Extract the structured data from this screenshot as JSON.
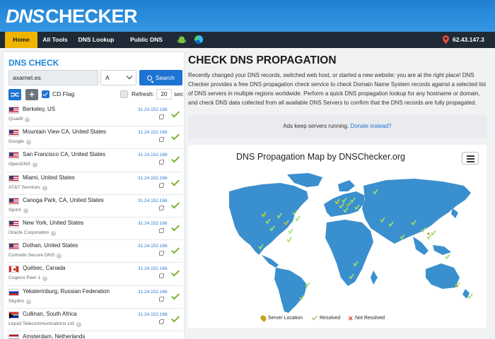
{
  "header": {
    "logo_dns": "DNS",
    "logo_checker": "CHECKER"
  },
  "nav": {
    "home": "Home",
    "all_tools": "All Tools",
    "dns_lookup": "DNS Lookup",
    "public_dns_list": "Public DNS List",
    "ip": "62.43.147.3"
  },
  "left": {
    "title": "DNS CHECK",
    "domain_value": "axarnet.es",
    "record_type": "A",
    "search_label": "Search",
    "cd_flag_label": "CD Flag",
    "refresh_label": "Refresh:",
    "refresh_value": "20",
    "refresh_unit": "sec."
  },
  "servers": [
    {
      "city": "Berkeley, US",
      "provider": "Quad9",
      "ip": "31.24.152.166",
      "flag": "us"
    },
    {
      "city": "Mountain View CA, United States",
      "provider": "Google",
      "ip": "31.24.152.166",
      "flag": "us"
    },
    {
      "city": "San Francisco CA, United States",
      "provider": "OpenDNS",
      "ip": "31.24.152.166",
      "flag": "us"
    },
    {
      "city": "Miami, United States",
      "provider": "AT&T Services",
      "ip": "31.24.152.166",
      "flag": "us"
    },
    {
      "city": "Canoga Park, CA, United States",
      "provider": "Sprint",
      "ip": "31.24.152.166",
      "flag": "us"
    },
    {
      "city": "New York, United States",
      "provider": "Oracle Corporation",
      "ip": "31.24.152.166",
      "flag": "us"
    },
    {
      "city": "Dothan, United States",
      "provider": "Comodo Secure DNS",
      "ip": "31.24.152.166",
      "flag": "us"
    },
    {
      "city": "Québec, Canada",
      "provider": "Cogeco Peer 1",
      "ip": "31.24.152.166",
      "flag": "ca"
    },
    {
      "city": "Yekaterinburg, Russian Federation",
      "provider": "Skydns",
      "ip": "31.24.152.166",
      "flag": "ru"
    },
    {
      "city": "Cullinan, South Africa",
      "provider": "Liquid Telecommunications Ltd",
      "ip": "31.24.152.166",
      "flag": "za"
    },
    {
      "city": "Amsterdam, Netherlands",
      "provider": "",
      "ip": "",
      "flag": "nl"
    }
  ],
  "main": {
    "title": "CHECK DNS PROPAGATION",
    "description": "Recently changed your DNS records, switched web host, or started a new website: you are at the right place! DNS Checker provides a free DNS propagation check service to check Domain Name System records against a selected list of DNS servers in multiple regions worldwide. Perform a quick DNS propagation lookup for any hostname or domain, and check DNS data collected from all available DNS Servers to confirm that the DNS records are fully propagated.",
    "ads_text": "Ads keep servers running.",
    "ads_link": "Donate instead?",
    "map_title": "DNS Propagation Map by DNSChecker.org",
    "legend": {
      "server_location": "Server Location",
      "resolved": "Resolved",
      "not_resolved": "Not Resolved"
    }
  },
  "colors": {
    "header_blue": "#2c8fde",
    "nav_dark": "#1f2a36",
    "home_accent": "#f0b400",
    "primary": "#1c73d2",
    "resolved_green": "#7ab235",
    "map_land": "#3a8fce"
  }
}
